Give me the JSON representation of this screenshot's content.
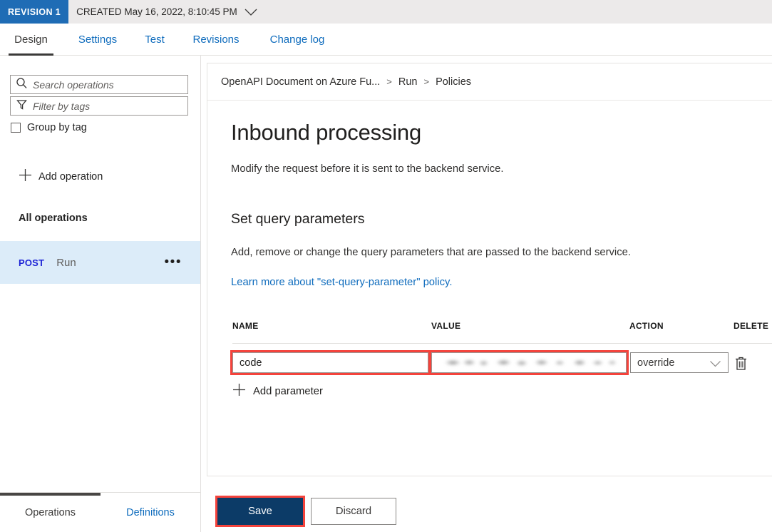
{
  "revision_bar": {
    "badge": "REVISION 1",
    "created_label": "CREATED May 16, 2022, 8:10:45 PM",
    "chevron_icon": "chevron-down-icon"
  },
  "tabs": [
    {
      "label": "Design",
      "active": true
    },
    {
      "label": "Settings",
      "active": false
    },
    {
      "label": "Test",
      "active": false
    },
    {
      "label": "Revisions",
      "active": false
    },
    {
      "label": "Change log",
      "active": false
    }
  ],
  "sidebar": {
    "search": {
      "placeholder": "Search operations",
      "value": "",
      "icon": "search-icon"
    },
    "filter": {
      "placeholder": "Filter by tags",
      "value": "",
      "icon": "funnel-icon"
    },
    "group_by_tag": {
      "label": "Group by tag",
      "checked": false
    },
    "add_operation": {
      "label": "Add operation",
      "icon": "plus-icon"
    },
    "section_title": "All operations",
    "operations": [
      {
        "method": "POST",
        "name": "Run",
        "selected": true,
        "more_icon": "ellipsis-icon"
      }
    ],
    "bottom_tabs": [
      {
        "label": "Operations",
        "active": true
      },
      {
        "label": "Definitions",
        "active": false
      }
    ]
  },
  "breadcrumb": {
    "items": [
      "OpenAPI Document on Azure Fu...",
      "Run",
      "Policies"
    ],
    "separator": ">"
  },
  "content": {
    "title": "Inbound processing",
    "subtitle": "Modify the request before it is sent to the backend service.",
    "section_title": "Set query parameters",
    "section_desc": "Add, remove or change the query parameters that are passed to the backend service.",
    "learn_more_link": "Learn more about \"set-query-parameter\" policy.",
    "table": {
      "headers": [
        "NAME",
        "VALUE",
        "ACTION",
        "DELETE"
      ],
      "rows": [
        {
          "name": "code",
          "value": "",
          "value_redacted": true,
          "action": "override",
          "delete_icon": "trash-icon",
          "name_highlighted": true,
          "value_highlighted": true
        }
      ]
    },
    "add_parameter": {
      "label": "Add parameter",
      "icon": "plus-icon"
    }
  },
  "footer": {
    "save_label": "Save",
    "discard_label": "Discard",
    "save_highlighted": true
  },
  "colors": {
    "revision_badge": "#1f6cb5",
    "revision_bar_bg": "#eceaea",
    "link": "#0f6cbd",
    "selected_row": "#dcecf9",
    "method_post": "#1f25d6",
    "highlight": "#f4433c",
    "primary_button": "#0c3b67"
  }
}
